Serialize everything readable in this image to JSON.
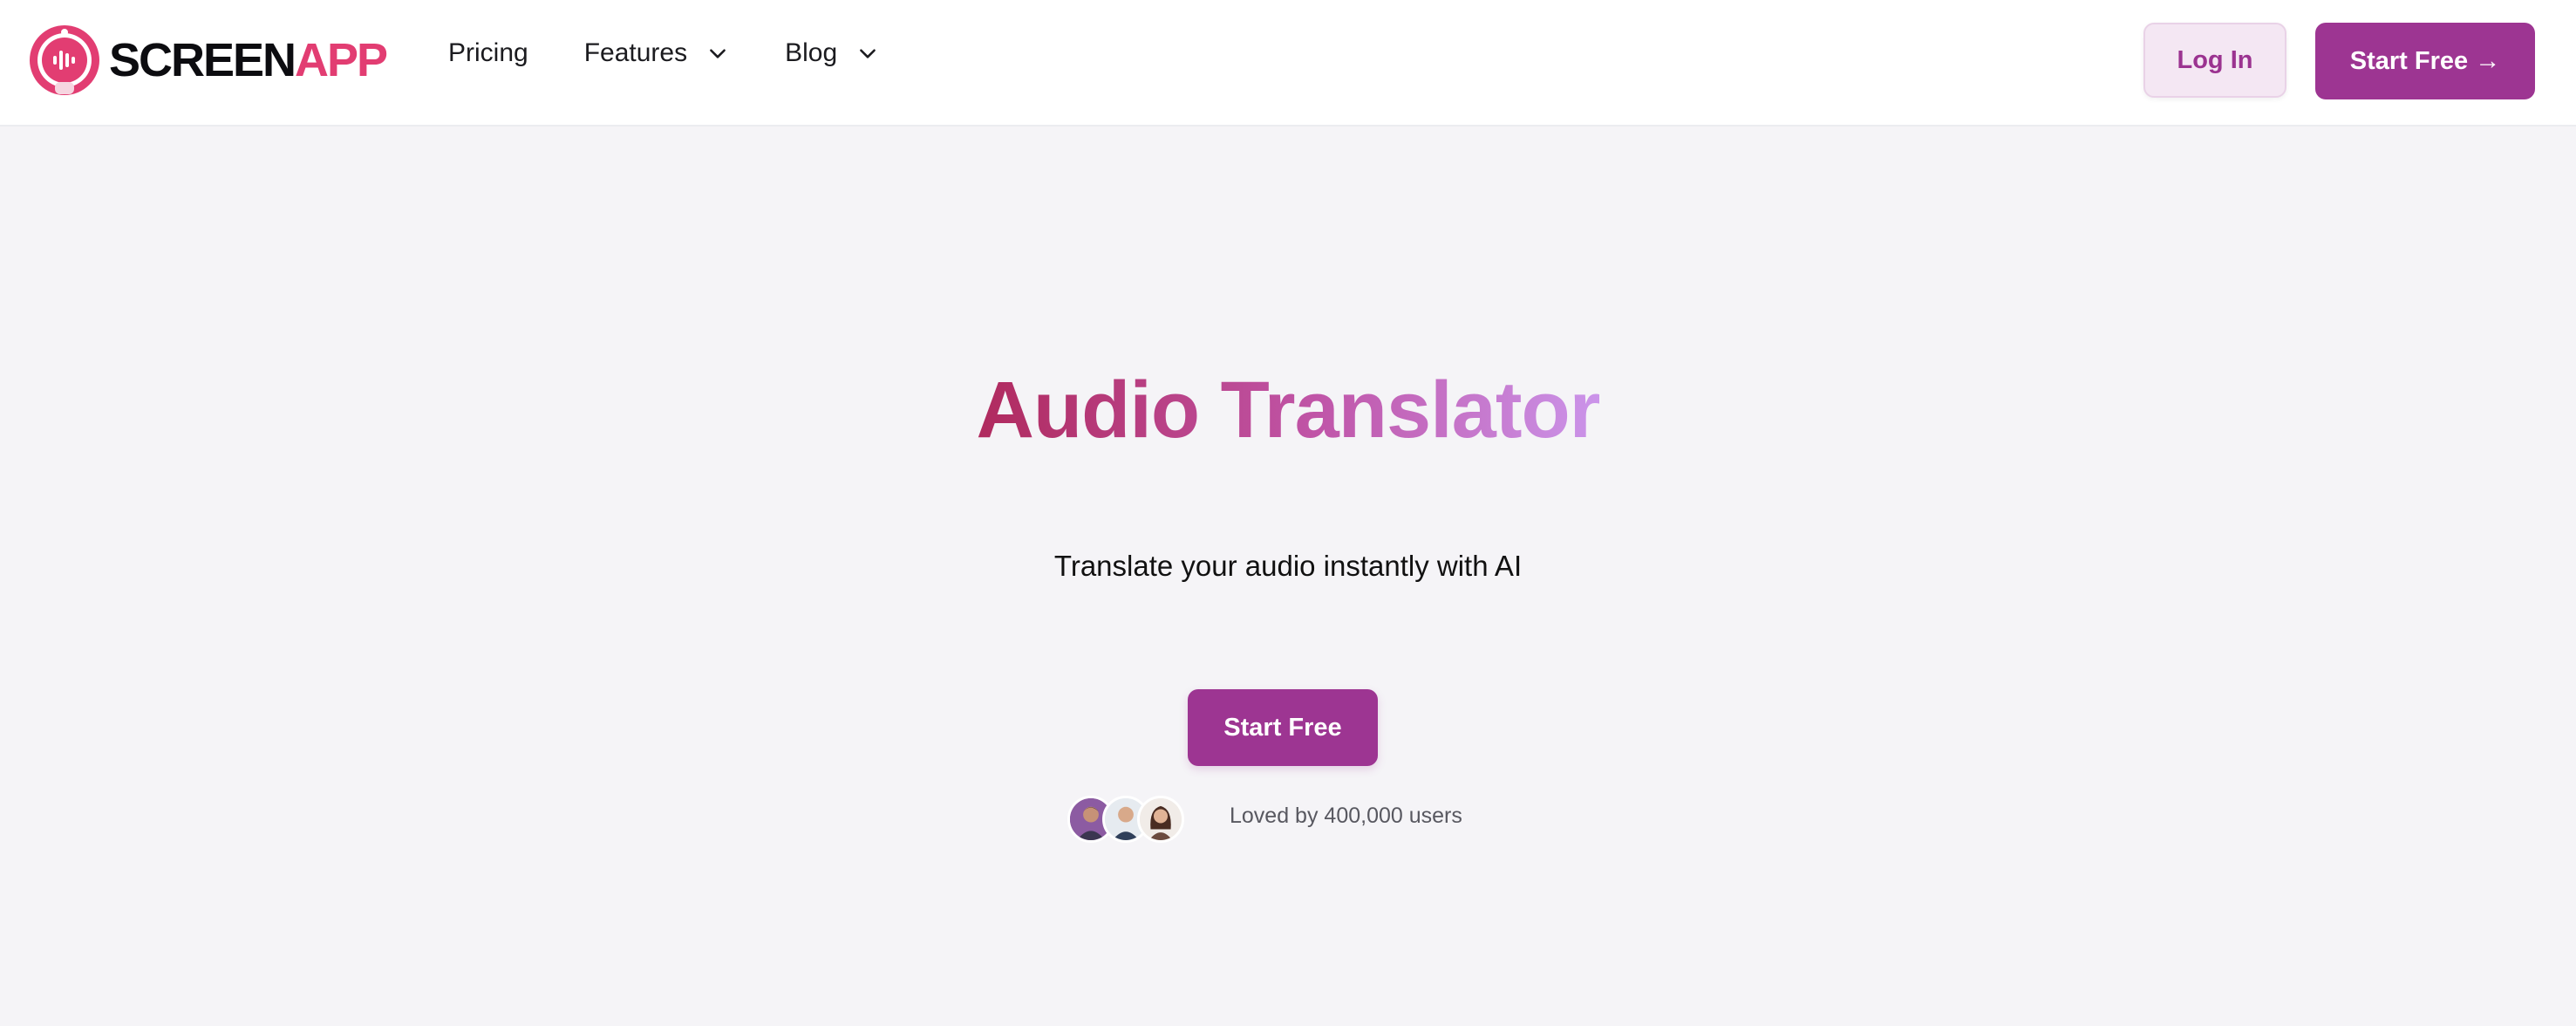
{
  "header": {
    "logo_word_1": "SCREEN",
    "logo_word_2": "APP",
    "nav": [
      {
        "label": "Pricing"
      },
      {
        "label": "Features"
      },
      {
        "label": "Blog"
      }
    ],
    "login_label": "Log In",
    "start_free_label": "Start Free →"
  },
  "hero": {
    "title": "Audio Translator",
    "subtitle": "Translate your audio instantly with AI",
    "cta_label": "Start Free",
    "social_proof": "Loved by 400,000 users"
  },
  "colors": {
    "brand_purple": "#9d3592",
    "logo_pink": "#e23d72",
    "title_gradient_start": "#b02a5e",
    "title_gradient_end": "#cb94ea"
  },
  "icons": {
    "logo": "robot-microphone-logo-icon",
    "dropdown": "chevron-down-icon"
  }
}
